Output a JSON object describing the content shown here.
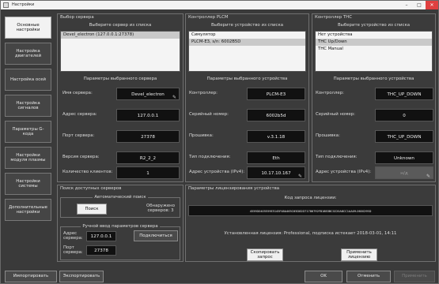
{
  "window": {
    "title": "Настройки"
  },
  "sidebar": {
    "items": [
      {
        "label": "Основные настройки"
      },
      {
        "label": "Настройка двигателей"
      },
      {
        "label": "Настройка осей"
      },
      {
        "label": "Настройка сигналов"
      },
      {
        "label": "Параметры G-кода"
      },
      {
        "label": "Настройки модуля плазмы"
      },
      {
        "label": "Настройки системы"
      },
      {
        "label": "Дополнительные настройки"
      }
    ]
  },
  "server": {
    "title": "Выбор сервера",
    "subtitle": "Выберите сервер из списка",
    "list": [
      "Devel_electron (127.0.0.1:27378)"
    ],
    "params_title": "Параметры выбранного сервера",
    "fields": [
      {
        "label": "Имя сервера:",
        "value": "Devel_electron"
      },
      {
        "label": "Адрес сервера:",
        "value": "127.0.0.1"
      },
      {
        "label": "Порт сервера:",
        "value": "27378"
      },
      {
        "label": "Версия сервера:",
        "value": "R2_2_2"
      },
      {
        "label": "Количество клиентов:",
        "value": "1"
      }
    ]
  },
  "plcm": {
    "title": "Контроллер PLCM",
    "subtitle": "Выберите устройство из списка",
    "list": [
      "Симулятор",
      "PLCM-E3, s/n: 6002B5D"
    ],
    "params_title": "Параметры выбранного устройства",
    "fields": [
      {
        "label": "Контроллер:",
        "value": "PLCM-E3"
      },
      {
        "label": "Серийный номер:",
        "value": "6002b5d"
      },
      {
        "label": "Прошивка:",
        "value": "v.3.1.18"
      },
      {
        "label": "Тип подключения:",
        "value": "Eth"
      },
      {
        "label": "Адрес устройства (IPv4):",
        "value": "10.17.10.167"
      }
    ]
  },
  "thc": {
    "title": "Контроллер THC",
    "subtitle": "Выберите устройство из списка",
    "list": [
      "Нет устройства",
      "THC Up/Down",
      "THC Manual"
    ],
    "params_title": "Параметры выбранного устройства",
    "fields": [
      {
        "label": "Контроллер:",
        "value": "THC_UP_DOWN"
      },
      {
        "label": "Серийный номер:",
        "value": "0"
      },
      {
        "label": "Прошивка:",
        "value": "THC_UP_DOWN"
      },
      {
        "label": "Тип подключения:",
        "value": "Unknown"
      },
      {
        "label": "Адрес устройства (IPv4):",
        "value": "н/д"
      }
    ]
  },
  "search": {
    "title": "Поиск доступных серверов",
    "auto_title": "Автоматический поиск",
    "search_button": "Поиск",
    "found_text": "Обнаружено серверов: 3",
    "manual_title": "Ручной ввод параметров сервера",
    "address_label": "Адрес сервера:",
    "address_value": "127.0.0.1",
    "port_label": "Порт сервера:",
    "port_value": "27378",
    "connect_button": "Подключиться"
  },
  "license": {
    "title": "Параметры лицензирования устройства",
    "request_title": "Код запроса лицензии:",
    "request_code": "4559D0405559E5145F48A465C65D82D71786792FB18B3BC0220A8CC1AA09-0600295D",
    "installed": "Установленная лицензия: Professional, подписка истекает 2018-03-01, 14:11",
    "copy_button": "Скопировать запрос",
    "apply_button": "Применить лицензию"
  },
  "footer": {
    "import": "Импортировать",
    "export": "Экспортировать",
    "ok": "OK",
    "cancel": "Отменить",
    "apply": "Применить"
  }
}
